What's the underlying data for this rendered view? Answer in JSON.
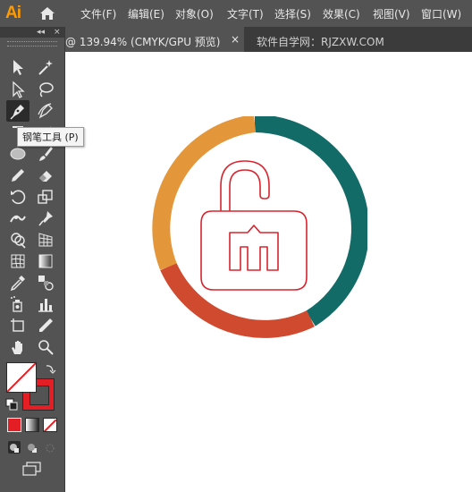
{
  "app": {
    "logo": "Ai"
  },
  "menu": [
    {
      "label": "文件(F)"
    },
    {
      "label": "编辑(E)"
    },
    {
      "label": "对象(O)"
    },
    {
      "label": "文字(T)"
    },
    {
      "label": "选择(S)"
    },
    {
      "label": "效果(C)"
    },
    {
      "label": "视图(V)"
    },
    {
      "label": "窗口(W)"
    }
  ],
  "tabs": {
    "active_title": "@ 139.94% (CMYK/GPU 预览)",
    "close_glyph": "×",
    "second_title": "软件自学网：RJZXW.COM"
  },
  "tooltip": {
    "text": "钢笔工具 (P)"
  },
  "colors": {
    "chrome": "#535353",
    "ring_orange": "#e4973a",
    "ring_teal": "#136b68",
    "ring_red": "#d04a2f",
    "lock_stroke": "#d9232e",
    "stroke_swatch": "#e31e24"
  },
  "tools": [
    "selection-tool-icon",
    "direct-selection-tool-icon",
    "magic-wand-tool-icon",
    "lasso-tool-icon",
    "pen-tool-icon",
    "curvature-tool-icon",
    "type-tool-icon",
    "line-segment-tool-icon",
    "ellipse-tool-icon",
    "paintbrush-tool-icon",
    "pencil-tool-icon",
    "eraser-tool-icon",
    "rotate-tool-icon",
    "scale-tool-icon",
    "width-tool-icon",
    "puppet-warp-tool-icon",
    "shape-builder-tool-icon",
    "perspective-grid-tool-icon",
    "mesh-tool-icon",
    "gradient-tool-icon",
    "eyedropper-tool-icon",
    "blend-tool-icon",
    "symbol-sprayer-tool-icon",
    "column-graph-tool-icon",
    "artboard-tool-icon",
    "slice-tool-icon",
    "hand-tool-icon",
    "zoom-tool-icon"
  ]
}
